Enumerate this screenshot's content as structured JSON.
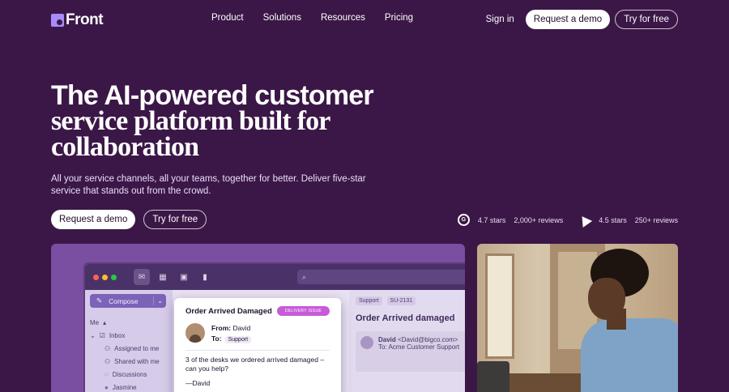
{
  "brand": {
    "name": "Front"
  },
  "nav": {
    "links": [
      "Product",
      "Solutions",
      "Resources",
      "Pricing"
    ],
    "signin": "Sign in",
    "demo": "Request a demo",
    "try": "Try for free"
  },
  "hero": {
    "title_line1": "The AI-powered customer",
    "title_line2": "service platform built for",
    "title_line3": "collaboration",
    "subtitle": "All your service channels, all your teams, together for better. Deliver five-star service that stands out from the crowd.",
    "demo": "Request a demo",
    "try": "Try for free"
  },
  "ratings": [
    {
      "icon": "g2-icon",
      "stars": "4.7 stars",
      "reviews": "2,000+ reviews"
    },
    {
      "icon": "capterra-icon",
      "stars": "4.5 stars",
      "reviews": "250+ reviews"
    }
  ],
  "app": {
    "compose": "Compose",
    "me": "Me",
    "inbox": "Inbox",
    "assigned": "Assigned to me",
    "shared": "Shared with me",
    "discussions": "Discussions",
    "jasmine": "Jasmine",
    "popup": {
      "title": "Order Arrived Damaged",
      "badge": "DELIVERY ISSUE",
      "from_label": "From:",
      "from": "David",
      "to_label": "To:",
      "to": "Support",
      "body": "3 of the desks we ordered arrived damaged – can you help?",
      "sign": "—David"
    },
    "conv": {
      "tag1": "Support",
      "tag2": "SU-2131",
      "title": "Order Arrived damaged",
      "sender": "David",
      "sender_email": "<David@bigco.com>",
      "to": "To: Acme Customer Support"
    }
  },
  "colors": {
    "background": "#3b1747",
    "accent": "#a78bfa",
    "badge": "#c75bd8"
  }
}
